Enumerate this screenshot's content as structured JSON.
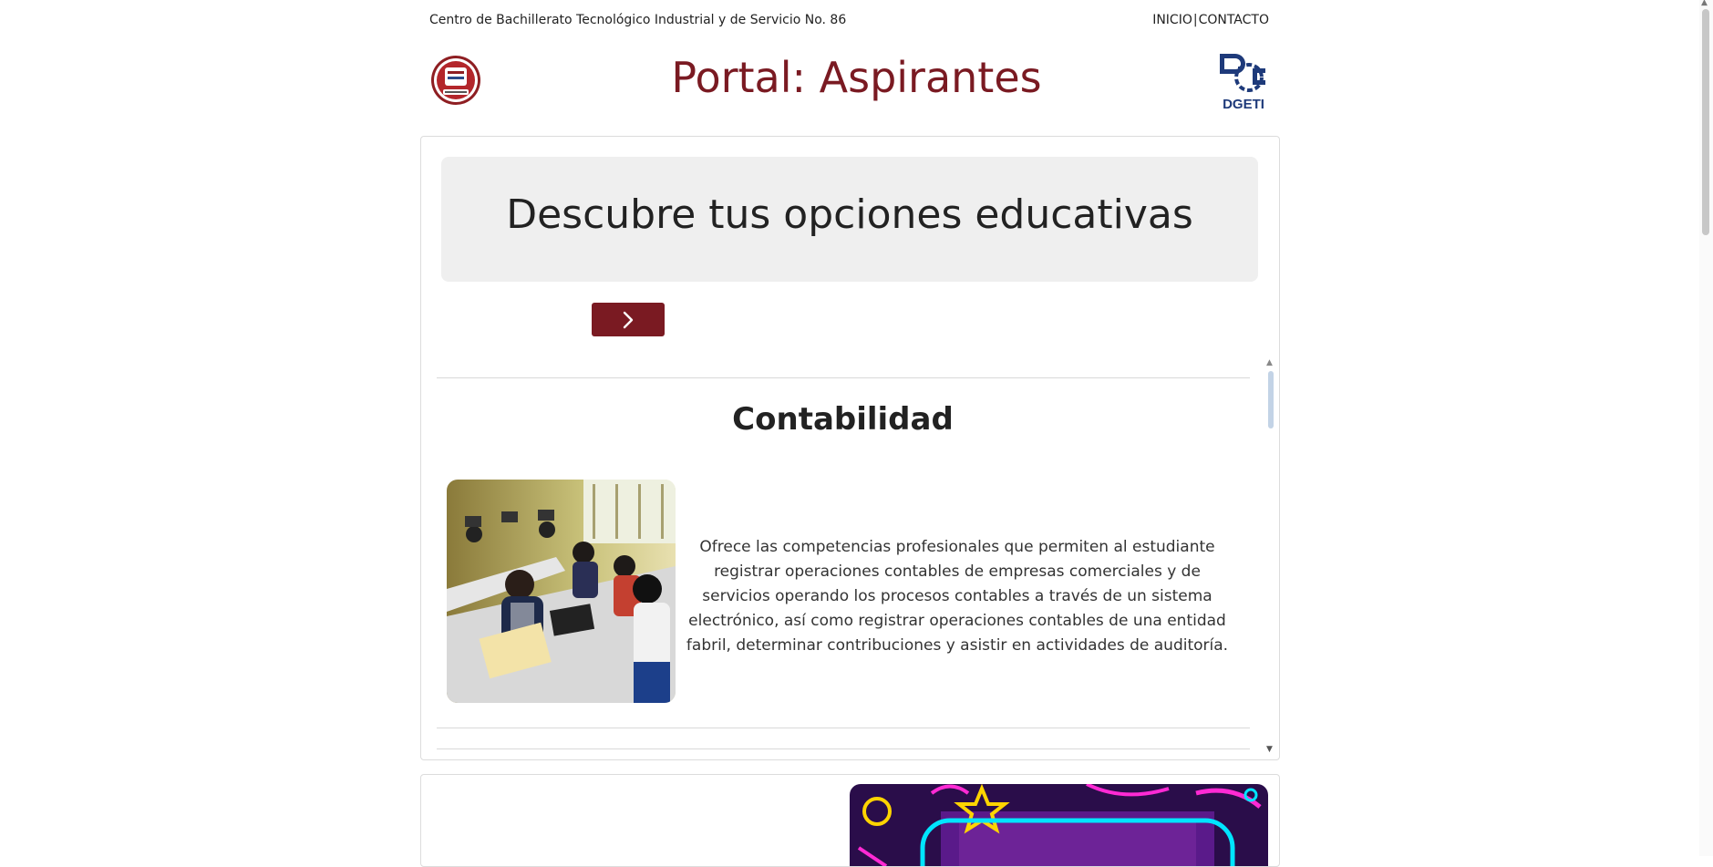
{
  "header": {
    "school_name": "Centro de Bachillerato Tecnológico Industrial y de Servicio No. 86",
    "nav": {
      "inicio": "INICIO",
      "separator": "|",
      "contacto": "CONTACTO"
    },
    "title": "Portal: Aspirantes",
    "right_logo_text": "DGETI"
  },
  "hero": {
    "heading": "Descubre tus opciones educativas"
  },
  "program": {
    "title": "Contabilidad",
    "description": "Ofrece las competencias profesionales que permiten al estudiante registrar operaciones contables de empresas comerciales y de servicios operando los procesos contables a través de un sistema electrónico, así como registrar operaciones contables de una entidad fabril, determinar contribuciones y asistir en actividades de auditoría."
  },
  "colors": {
    "brand": "#7a1a22",
    "hero_bg": "#efefef",
    "dgeti_blue": "#1e3a7a"
  },
  "icons": {
    "next": "chevron-right-icon",
    "scroll_up": "caret-up-icon",
    "scroll_down": "caret-down-icon"
  }
}
